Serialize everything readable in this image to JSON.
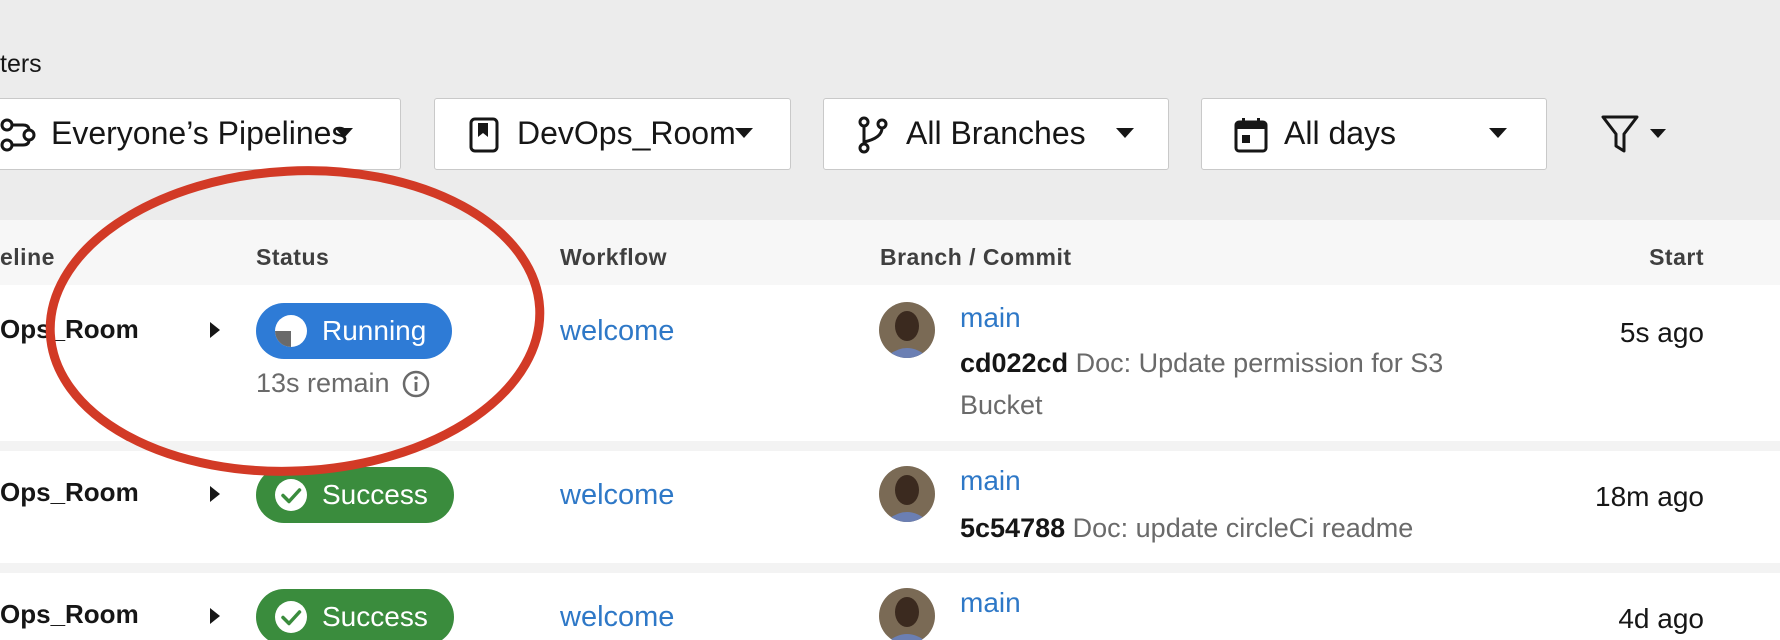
{
  "filters": {
    "label": "ters",
    "pipelines": "Everyone’s Pipelines",
    "project": "DevOps_Room",
    "branches": "All Branches",
    "days": "All days"
  },
  "table": {
    "headers": {
      "pipeline": "eline",
      "status": "Status",
      "workflow": "Workflow",
      "branch_commit": "Branch / Commit",
      "start": "Start"
    },
    "rows": [
      {
        "pipeline": "Ops_Room",
        "status": "Running",
        "remain": "13s remain",
        "workflow": "welcome",
        "branch": "main",
        "commit_hash": "cd022cd",
        "commit_message": "Doc: Update permission for S3 Bucket",
        "start": "5s ago"
      },
      {
        "pipeline": "Ops_Room",
        "status": "Success",
        "workflow": "welcome",
        "branch": "main",
        "commit_hash": "5c54788",
        "commit_message": "Doc: update circleCi readme",
        "start": "18m ago"
      },
      {
        "pipeline": "Ops_Room",
        "status": "Success",
        "workflow": "welcome",
        "branch": "main",
        "commit_hash": "",
        "commit_message": "",
        "start": "4d ago"
      }
    ]
  },
  "colors": {
    "running": "#2e7bd6",
    "success": "#3a8c3d",
    "link": "#2e78c7",
    "annotation": "#d23a26"
  },
  "icons": {
    "pipelines": "pipelines-icon",
    "project": "bookmark-icon",
    "branches": "git-branch-icon",
    "days": "calendar-icon",
    "more_filters": "funnel-icon",
    "running": "running-progress-icon",
    "success": "check-circle-icon",
    "info": "info-icon"
  }
}
